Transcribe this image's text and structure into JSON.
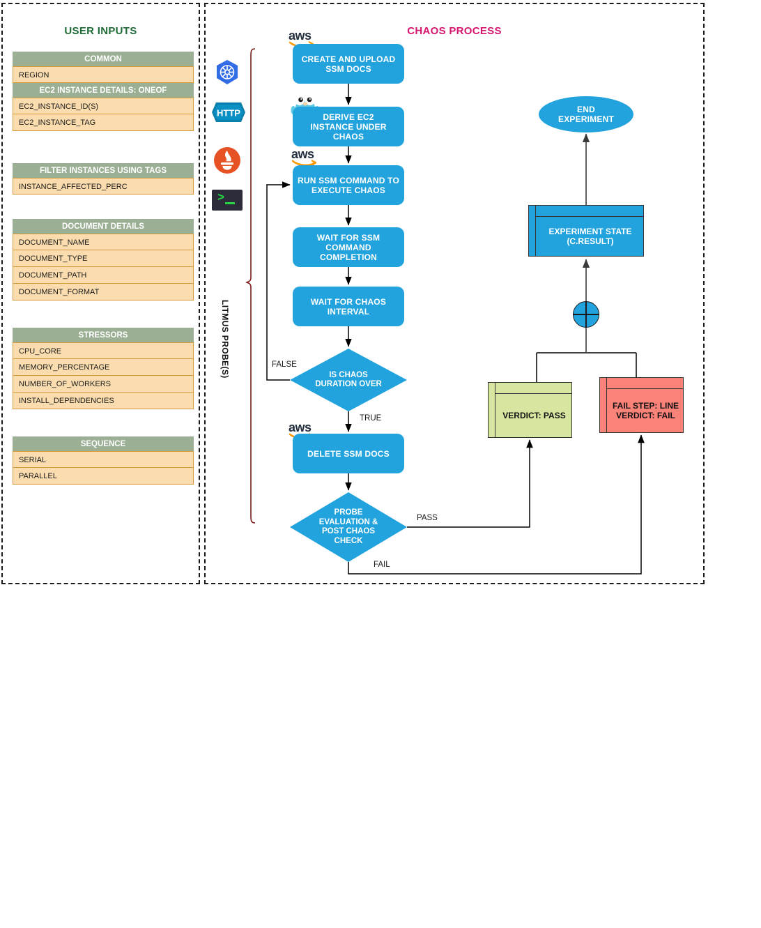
{
  "panels": {
    "user_inputs": {
      "title": "USER INPUTS",
      "color": "#1e6b36"
    },
    "chaos_process": {
      "title": "CHAOS PROCESS",
      "color": "#d6156e"
    }
  },
  "colors": {
    "process_blue": "#22a3dd",
    "header_green": "#9aaf93",
    "row_orange": "#fadcae",
    "row_border": "#d79b3c",
    "verdict_pass_green": "#d6e6a0",
    "verdict_fail_red": "#fa8379",
    "bracket_maroon": "#7b1b1b"
  },
  "user_inputs": {
    "groups": [
      {
        "header": "COMMON",
        "rows": [
          "REGION"
        ],
        "subheader": "EC2 INSTANCE DETAILS: ONEOF",
        "subrows": [
          "EC2_INSTANCE_ID(S)",
          "EC2_INSTANCE_TAG"
        ]
      },
      {
        "header": "FILTER INSTANCES USING TAGS",
        "rows": [
          "INSTANCE_AFFECTED_PERC"
        ]
      },
      {
        "header": "DOCUMENT DETAILS",
        "rows": [
          "DOCUMENT_NAME",
          "DOCUMENT_TYPE",
          "DOCUMENT_PATH",
          "DOCUMENT_FORMAT"
        ]
      },
      {
        "header": "STRESSORS",
        "rows": [
          "CPU_CORE",
          "MEMORY_PERCENTAGE",
          "NUMBER_OF_WORKERS",
          "INSTALL_DEPENDENCIES"
        ]
      },
      {
        "header": "SEQUENCE",
        "rows": [
          "SERIAL",
          "PARALLEL"
        ]
      }
    ]
  },
  "probe_icons": [
    {
      "name": "kubernetes-icon",
      "label": ""
    },
    {
      "name": "http-icon",
      "label": "HTTP"
    },
    {
      "name": "prometheus-icon",
      "label": ""
    },
    {
      "name": "command-terminal-icon",
      "label": ""
    }
  ],
  "bracket": {
    "label": "LITMUS PROBE(S)"
  },
  "flow": {
    "nodes": [
      {
        "id": "create-upload-ssm-docs",
        "label": "CREATE AND UPLOAD\nSSM DOCS",
        "shape": "process",
        "icon": "aws"
      },
      {
        "id": "derive-ec2-instance",
        "label": "DERIVE EC2\nINSTANCE UNDER CHAOS",
        "shape": "process",
        "icon": "gopher"
      },
      {
        "id": "run-ssm-command",
        "label": "RUN SSM COMMAND TO\nEXECUTE CHAOS",
        "shape": "process",
        "icon": "aws"
      },
      {
        "id": "wait-ssm-completion",
        "label": "WAIT FOR SSM COMMAND\nCOMPLETION",
        "shape": "process",
        "icon": ""
      },
      {
        "id": "wait-chaos-interval",
        "label": "WAIT FOR CHAOS\nINTERVAL",
        "shape": "process",
        "icon": ""
      },
      {
        "id": "is-chaos-duration-over",
        "label": "IS CHAOS\nDURATION OVER",
        "shape": "decision",
        "icon": ""
      },
      {
        "id": "delete-ssm-docs",
        "label": "DELETE SSM DOCS",
        "shape": "process",
        "icon": "aws"
      },
      {
        "id": "probe-evaluation",
        "label": "PROBE\nEVALUATION &\nPOST CHAOS\nCHECK",
        "shape": "decision",
        "icon": ""
      },
      {
        "id": "verdict-pass",
        "label": "VERDICT: PASS",
        "shape": "object",
        "icon": ""
      },
      {
        "id": "verdict-fail",
        "label": "FAIL STEP: LINE\nVERDICT: FAIL",
        "shape": "object",
        "icon": ""
      },
      {
        "id": "experiment-state",
        "label": "EXPERIMENT STATE\n(C.RESULT)",
        "shape": "object",
        "icon": ""
      },
      {
        "id": "end-experiment",
        "label": "END\nEXPERIMENT",
        "shape": "terminal",
        "icon": ""
      }
    ],
    "edge_labels": {
      "false": "FALSE",
      "true": "TRUE",
      "pass": "PASS",
      "fail": "FAIL"
    }
  },
  "node_text": {
    "create_upload_l1": "CREATE AND UPLOAD",
    "create_upload_l2": "SSM DOCS",
    "derive_l1": "DERIVE EC2",
    "derive_l2": "INSTANCE UNDER CHAOS",
    "run_ssm_l1": "RUN SSM COMMAND TO",
    "run_ssm_l2": "EXECUTE CHAOS",
    "wait_ssm_l1": "WAIT FOR SSM COMMAND",
    "wait_ssm_l2": "COMPLETION",
    "wait_interval_l1": "WAIT FOR CHAOS",
    "wait_interval_l2": "INTERVAL",
    "is_chaos_l1": "IS CHAOS",
    "is_chaos_l2": "DURATION OVER",
    "delete_ssm": "DELETE SSM DOCS",
    "probe_l1": "PROBE",
    "probe_l2": "EVALUATION &",
    "probe_l3": "POST CHAOS",
    "probe_l4": "CHECK",
    "verdict_pass": "VERDICT: PASS",
    "verdict_fail_l1": "FAIL STEP: LINE",
    "verdict_fail_l2": "VERDICT: FAIL",
    "exp_state_l1": "EXPERIMENT STATE",
    "exp_state_l2": "(C.RESULT)",
    "end_l1": "END",
    "end_l2": "EXPERIMENT",
    "aws_wordmark": "aws"
  }
}
